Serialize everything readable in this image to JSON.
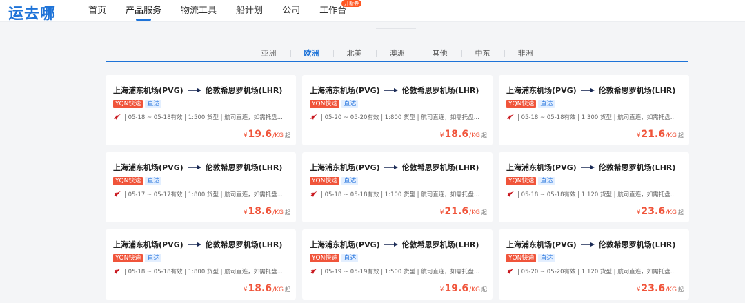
{
  "header": {
    "logo": "运去哪",
    "nav": [
      {
        "label": "首页",
        "active": false
      },
      {
        "label": "产品服务",
        "active": true
      },
      {
        "label": "物流工具",
        "active": false
      },
      {
        "label": "船计划",
        "active": false
      },
      {
        "label": "公司",
        "active": false
      },
      {
        "label": "工作台",
        "active": false
      }
    ],
    "workbench_badge": "开新券"
  },
  "regions": [
    {
      "label": "亚洲",
      "active": false
    },
    {
      "label": "欧洲",
      "active": true
    },
    {
      "label": "北美",
      "active": false
    },
    {
      "label": "澳洲",
      "active": false
    },
    {
      "label": "其他",
      "active": false
    },
    {
      "label": "中东",
      "active": false
    },
    {
      "label": "非洲",
      "active": false
    }
  ],
  "colors": {
    "accent": "#1e73d8",
    "price": "#f0543a",
    "airline": "#c8161d"
  },
  "cards": [
    {
      "origin": "上海浦东机场(PVG)",
      "destination": "伦敦希思罗机场(LHR)",
      "tag_service": "YQN快速",
      "tag_route": "直达",
      "info": "| 05-18 ~ 05-18有效 | 1:500 货型 | 航司直连，如需托盘...",
      "currency": "¥",
      "price": "19.6",
      "unit": "/KG",
      "suffix": "起"
    },
    {
      "origin": "上海浦东机场(PVG)",
      "destination": "伦敦希思罗机场(LHR)",
      "tag_service": "YQN快速",
      "tag_route": "直达",
      "info": "| 05-20 ~ 05-20有效 | 1:800 货型 | 航司直连，如需托盘...",
      "currency": "¥",
      "price": "18.6",
      "unit": "/KG",
      "suffix": "起"
    },
    {
      "origin": "上海浦东机场(PVG)",
      "destination": "伦敦希思罗机场(LHR)",
      "tag_service": "YQN快速",
      "tag_route": "直达",
      "info": "| 05-18 ~ 05-18有效 | 1:300 货型 | 航司直连，如需托盘...",
      "currency": "¥",
      "price": "21.6",
      "unit": "/KG",
      "suffix": "起"
    },
    {
      "origin": "上海浦东机场(PVG)",
      "destination": "伦敦希思罗机场(LHR)",
      "tag_service": "YQN快速",
      "tag_route": "直达",
      "info": "| 05-17 ~ 05-17有效 | 1:800 货型 | 航司直连，如需托盘...",
      "currency": "¥",
      "price": "18.6",
      "unit": "/KG",
      "suffix": "起"
    },
    {
      "origin": "上海浦东机场(PVG)",
      "destination": "伦敦希思罗机场(LHR)",
      "tag_service": "YQN快速",
      "tag_route": "直达",
      "info": "| 05-18 ~ 05-18有效 | 1:100 货型 | 航司直连，如需托盘...",
      "currency": "¥",
      "price": "21.6",
      "unit": "/KG",
      "suffix": "起"
    },
    {
      "origin": "上海浦东机场(PVG)",
      "destination": "伦敦希思罗机场(LHR)",
      "tag_service": "YQN快速",
      "tag_route": "直达",
      "info": "| 05-18 ~ 05-18有效 | 1:120 货型 | 航司直连，如需托盘...",
      "currency": "¥",
      "price": "23.6",
      "unit": "/KG",
      "suffix": "起"
    },
    {
      "origin": "上海浦东机场(PVG)",
      "destination": "伦敦希思罗机场(LHR)",
      "tag_service": "YQN快速",
      "tag_route": "直达",
      "info": "| 05-18 ~ 05-18有效 | 1:800 货型 | 航司直连，如需托盘...",
      "currency": "¥",
      "price": "18.6",
      "unit": "/KG",
      "suffix": "起"
    },
    {
      "origin": "上海浦东机场(PVG)",
      "destination": "伦敦希思罗机场(LHR)",
      "tag_service": "YQN快速",
      "tag_route": "直达",
      "info": "| 05-19 ~ 05-19有效 | 1:500 货型 | 航司直连，如需托盘...",
      "currency": "¥",
      "price": "19.6",
      "unit": "/KG",
      "suffix": "起"
    },
    {
      "origin": "上海浦东机场(PVG)",
      "destination": "伦敦希思罗机场(LHR)",
      "tag_service": "YQN快速",
      "tag_route": "直达",
      "info": "| 05-20 ~ 05-20有效 | 1:120 货型 | 航司直连，如需托盘...",
      "currency": "¥",
      "price": "23.6",
      "unit": "/KG",
      "suffix": "起"
    }
  ]
}
